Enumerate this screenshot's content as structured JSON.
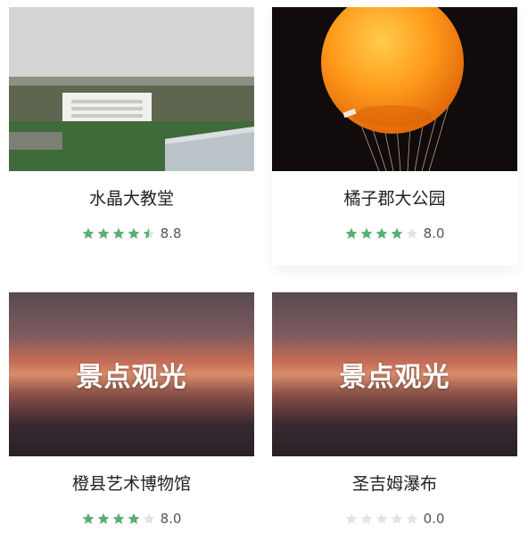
{
  "cards": [
    {
      "title": "水晶大教堂",
      "score": "8.8",
      "rating": 4.5,
      "placeholder": ""
    },
    {
      "title": "橘子郡大公园",
      "score": "8.0",
      "rating": 4,
      "placeholder": ""
    },
    {
      "title": "橙县艺术博物馆",
      "score": "8.0",
      "rating": 4,
      "placeholder": "景点观光"
    },
    {
      "title": "圣吉姆瀑布",
      "score": "0.0",
      "rating": 0,
      "placeholder": "景点观光"
    }
  ],
  "colors": {
    "star_on": "#5aae72",
    "star_off": "#e3e3e3",
    "title": "#222222"
  }
}
